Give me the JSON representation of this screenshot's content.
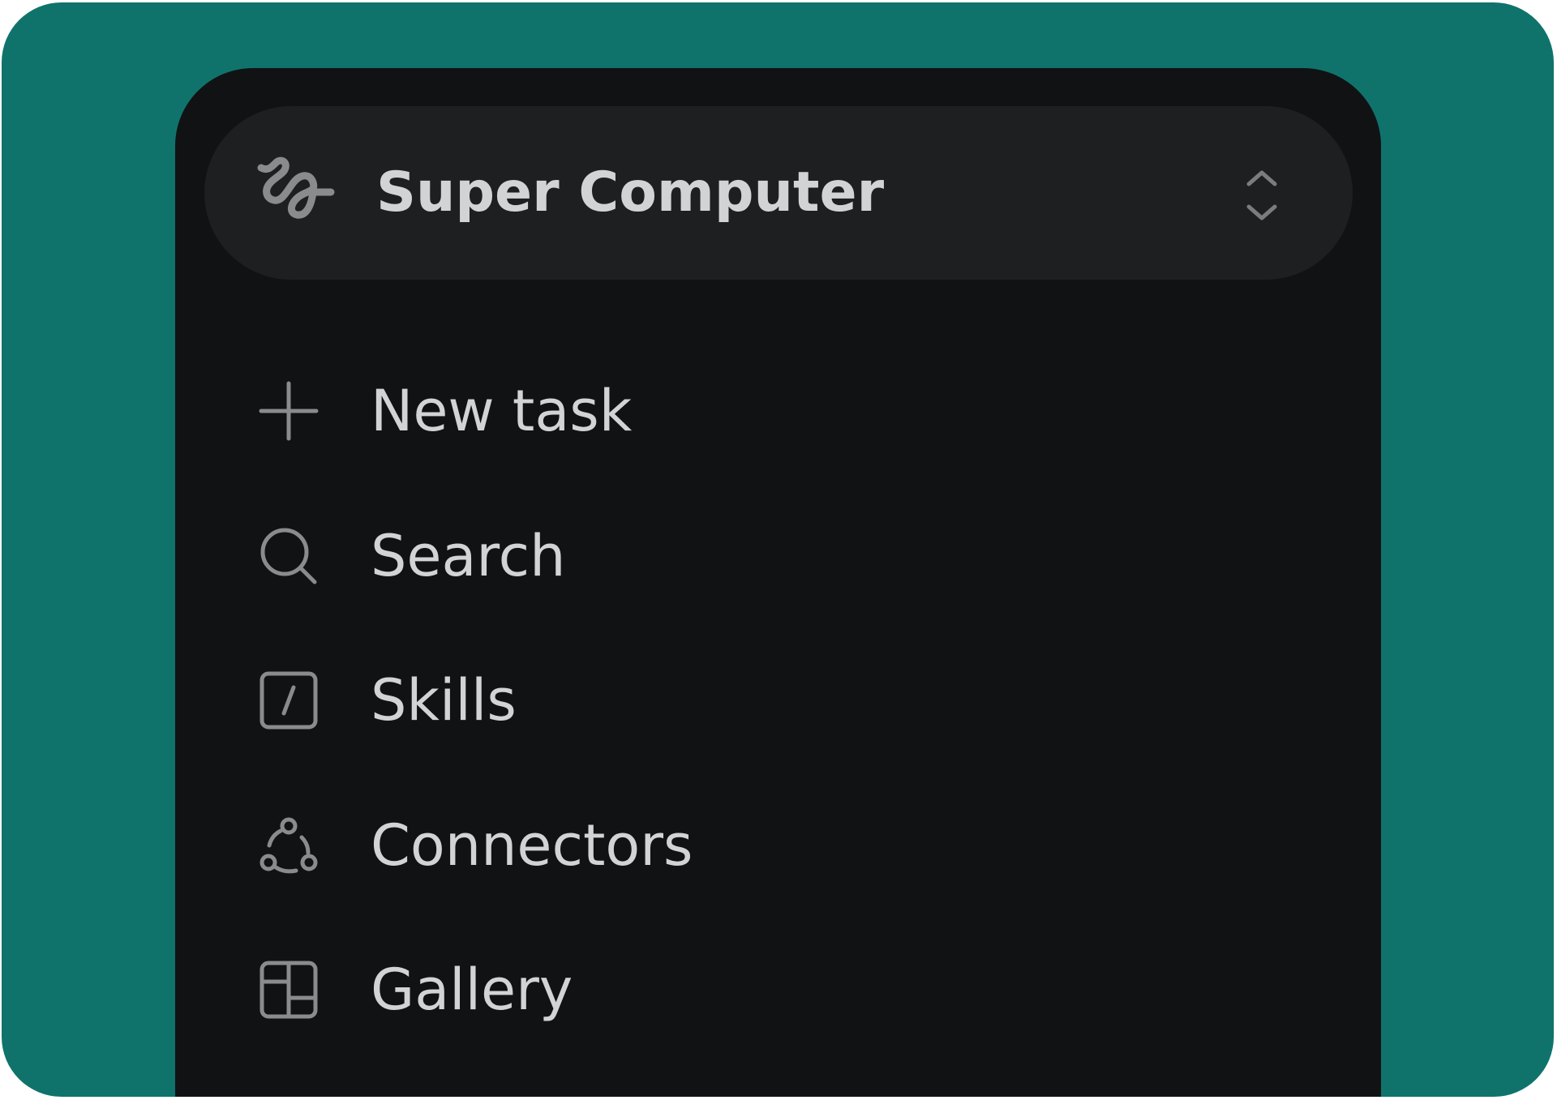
{
  "workspace": {
    "name": "Super Computer",
    "logo_icon": "squiggle-logo-icon",
    "switch_icon": "chevron-up-down-icon"
  },
  "nav": {
    "items": [
      {
        "label": "New task",
        "icon": "plus-icon"
      },
      {
        "label": "Search",
        "icon": "search-icon"
      },
      {
        "label": "Skills",
        "icon": "slash-square-icon"
      },
      {
        "label": "Connectors",
        "icon": "connectors-icon"
      },
      {
        "label": "Gallery",
        "icon": "layout-grid-icon"
      }
    ]
  },
  "colors": {
    "frame_background": "#0f736c",
    "sidebar_background": "#111214",
    "switcher_background": "#1e1f21",
    "text": "#d2d3d5",
    "icon": "#8a8b8d"
  }
}
